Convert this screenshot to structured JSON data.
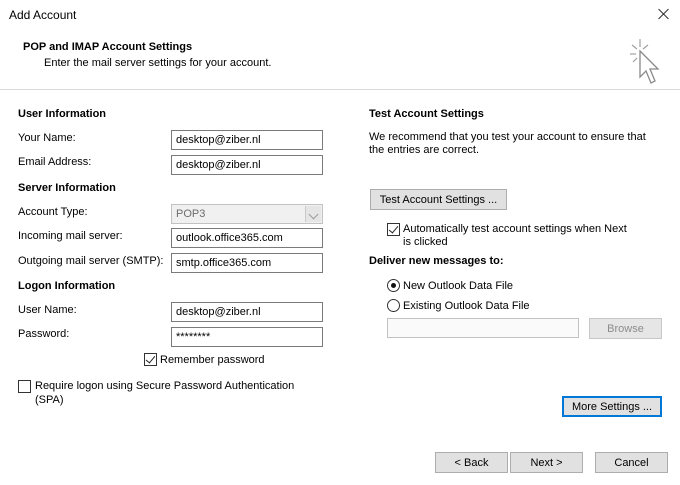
{
  "window": {
    "title": "Add Account"
  },
  "header": {
    "title": "POP and IMAP Account Settings",
    "subtitle": "Enter the mail server settings for your account."
  },
  "user_info": {
    "heading": "User Information",
    "name_label": "Your Name:",
    "name_value": "desktop@ziber.nl",
    "email_label": "Email Address:",
    "email_value": "desktop@ziber.nl"
  },
  "server_info": {
    "heading": "Server Information",
    "account_type_label": "Account Type:",
    "account_type_value": "POP3",
    "incoming_label": "Incoming mail server:",
    "incoming_value": "outlook.office365.com",
    "outgoing_label": "Outgoing mail server (SMTP):",
    "outgoing_value": "smtp.office365.com"
  },
  "logon_info": {
    "heading": "Logon Information",
    "username_label": "User Name:",
    "username_value": "desktop@ziber.nl",
    "password_label": "Password:",
    "password_value": "********",
    "remember_label": "Remember password",
    "remember_checked": true,
    "spa_label_line1": "Require logon using Secure Password Authentication",
    "spa_label_line2": "(SPA)",
    "spa_checked": false
  },
  "test_settings": {
    "heading": "Test Account Settings",
    "description_line1": "We recommend that you test your account to ensure that",
    "description_line2": "the entries are correct.",
    "test_button": "Test Account Settings ...",
    "auto_test_line1": "Automatically test account settings when Next",
    "auto_test_line2": "is clicked",
    "auto_test_checked": true
  },
  "deliver": {
    "heading": "Deliver new messages to:",
    "new_file_label": "New Outlook Data File",
    "existing_file_label": "Existing Outlook Data File",
    "selected": "new",
    "existing_path_value": "",
    "browse_button": "Browse"
  },
  "more_settings_button": "More Settings ...",
  "footer": {
    "back_button": "< Back",
    "next_button": "Next >",
    "cancel_button": "Cancel"
  },
  "colors": {
    "accent": "#0078d7",
    "button_face": "#e1e1e1",
    "border": "#7a7a7a"
  }
}
